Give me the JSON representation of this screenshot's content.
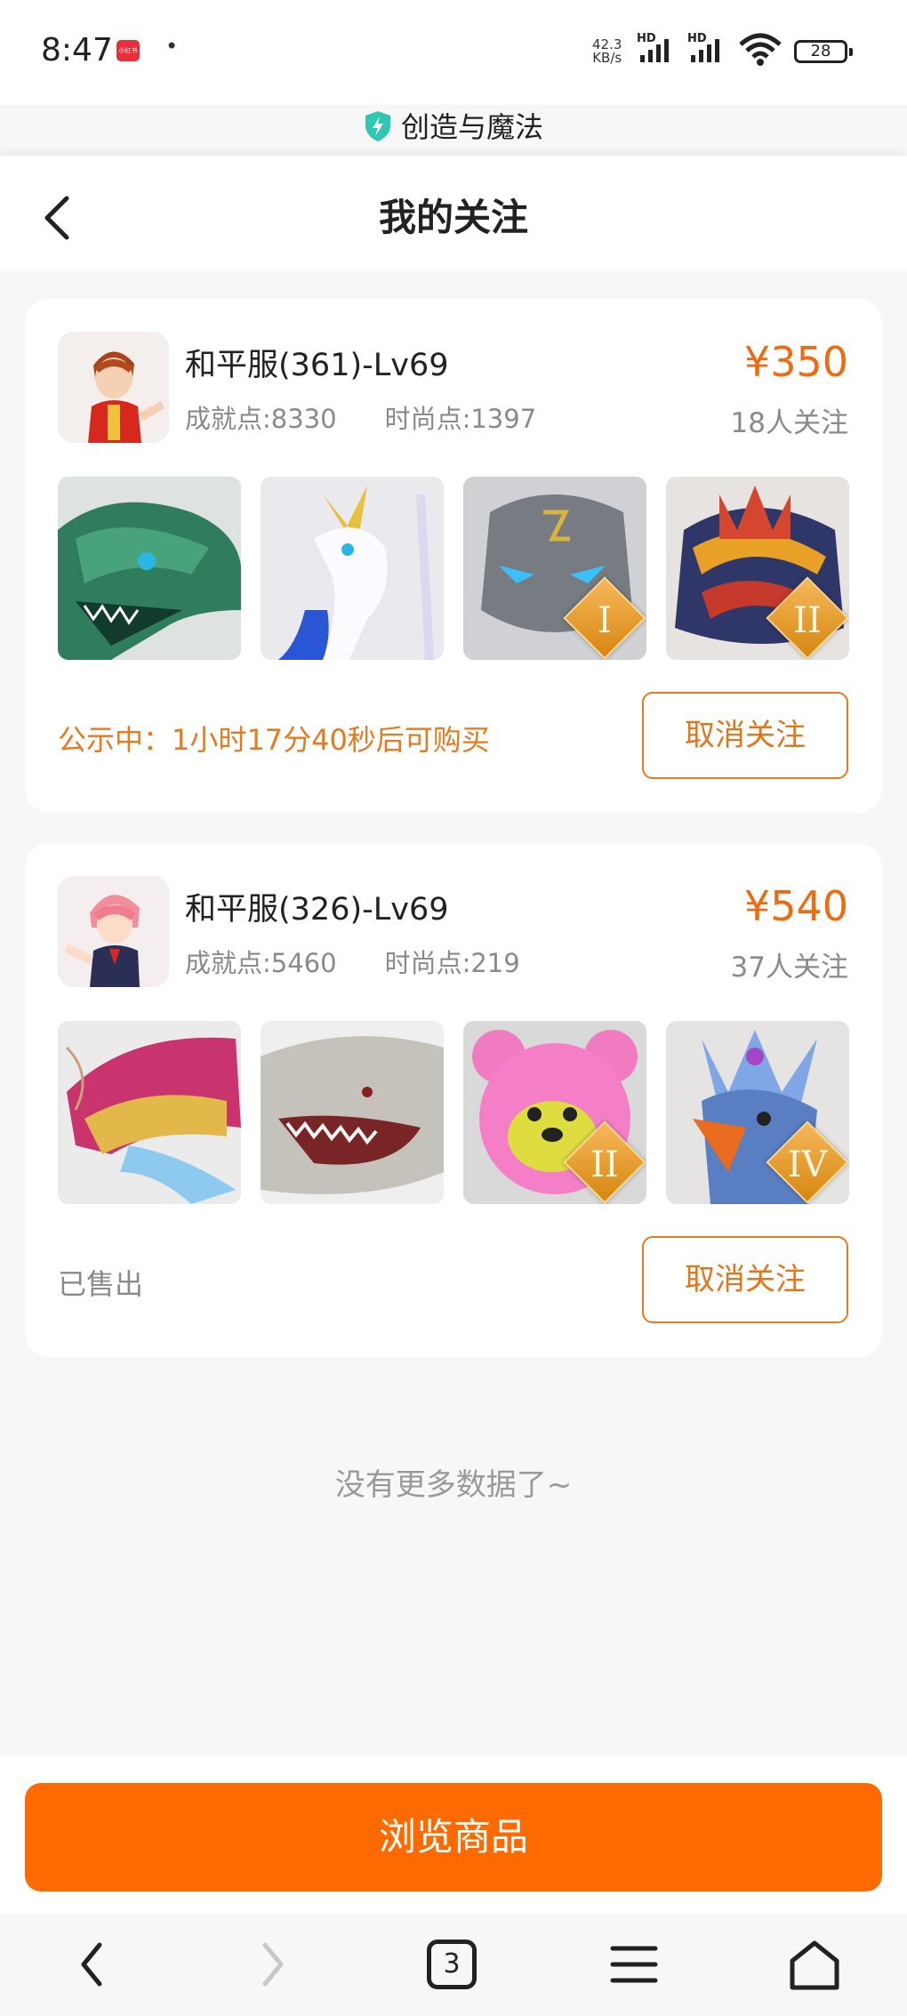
{
  "status_bar": {
    "time": "8:47",
    "app_badge": "小红书",
    "dot": "•",
    "net_speed_value": "42.3",
    "net_speed_unit": "KB/s",
    "hd_label": "HD",
    "battery": "28"
  },
  "app_name": "创造与魔法",
  "page_title": "我的关注",
  "listings": [
    {
      "name": "和平服(361)-Lv69",
      "achievement": "成就点:8330",
      "fashion": "时尚点:1397",
      "price": "¥350",
      "followers": "18人关注",
      "status": "公示中：1小时17分40秒后可购买",
      "action": "取消关注",
      "thumb_ranks": [
        "",
        "",
        "I",
        "II"
      ]
    },
    {
      "name": "和平服(326)-Lv69",
      "achievement": "成就点:5460",
      "fashion": "时尚点:219",
      "price": "¥540",
      "followers": "37人关注",
      "status": "已售出",
      "action": "取消关注",
      "thumb_ranks": [
        "",
        "",
        "II",
        "IV"
      ]
    }
  ],
  "no_more": "没有更多数据了~",
  "browse_button": "浏览商品",
  "nav": {
    "tabs_count": "3",
    "icons": [
      "back-icon",
      "forward-icon",
      "tabs-icon",
      "menu-icon",
      "home-icon"
    ]
  },
  "colors": {
    "accent": "#ff6a00",
    "price": "#ef6b11",
    "muted": "#8a8a8a",
    "shield": "#2fc7b4"
  }
}
